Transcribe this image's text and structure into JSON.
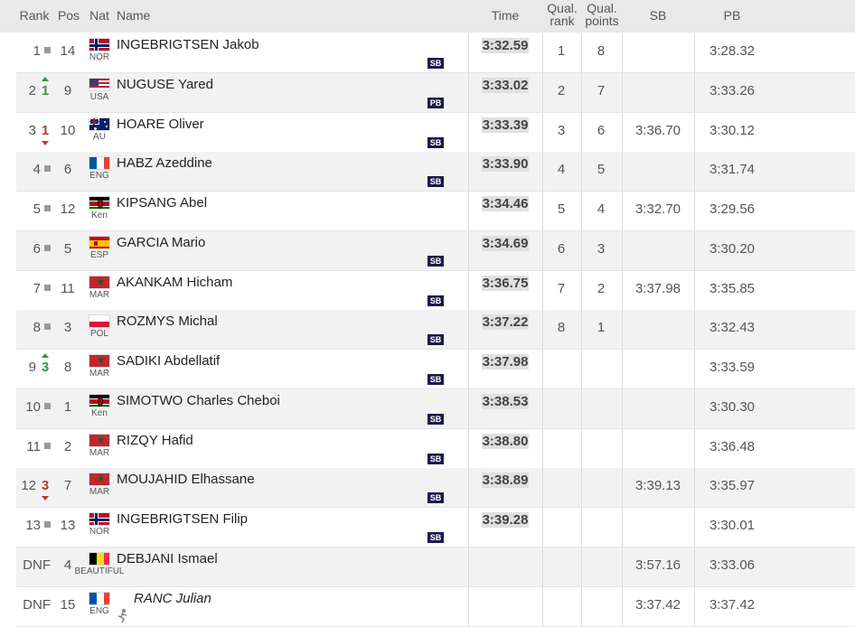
{
  "headers": {
    "rank": "Rank",
    "pos": "Pos",
    "nat": "Nat",
    "name": "Name",
    "time": "Time",
    "qual_rank_1": "Qual.",
    "qual_rank_2": "rank",
    "qual_points_1": "Qual.",
    "qual_points_2": "points",
    "sb": "SB",
    "pb": "PB"
  },
  "rows": [
    {
      "rank": "1",
      "move": "same",
      "move_n": "",
      "pos": "14",
      "flag": "flag-norway-icon",
      "nat": "NOR",
      "name": "INGEBRIGTSEN Jakob",
      "badge": "SB",
      "time": "3:32.59",
      "qual_rank": "1",
      "qual_points": "8",
      "sb": "",
      "pb": "3:28.32"
    },
    {
      "rank": "2",
      "move": "up",
      "move_n": "1",
      "pos": "9",
      "flag": "flag-usa-icon",
      "nat": "USA",
      "name": "NUGUSE Yared",
      "badge": "PB",
      "time": "3:33.02",
      "qual_rank": "2",
      "qual_points": "7",
      "sb": "",
      "pb": "3:33.26"
    },
    {
      "rank": "3",
      "move": "down",
      "move_n": "1",
      "pos": "10",
      "flag": "flag-australia-icon",
      "nat": "AU",
      "name": "HOARE Oliver",
      "badge": "SB",
      "time": "3:33.39",
      "qual_rank": "3",
      "qual_points": "6",
      "sb": "3:36.70",
      "pb": "3:30.12"
    },
    {
      "rank": "4",
      "move": "same",
      "move_n": "",
      "pos": "6",
      "flag": "flag-france-icon",
      "nat": "ENG",
      "name": "HABZ Azeddine",
      "badge": "SB",
      "time": "3:33.90",
      "qual_rank": "4",
      "qual_points": "5",
      "sb": "",
      "pb": "3:31.74"
    },
    {
      "rank": "5",
      "move": "same",
      "move_n": "",
      "pos": "12",
      "flag": "flag-kenya-icon",
      "nat": "Ken",
      "name": "KIPSANG Abel",
      "badge": "",
      "time": "3:34.46",
      "qual_rank": "5",
      "qual_points": "4",
      "sb": "3:32.70",
      "pb": "3:29.56"
    },
    {
      "rank": "6",
      "move": "same",
      "move_n": "",
      "pos": "5",
      "flag": "flag-spain-icon",
      "nat": "ESP",
      "name": "GARCIA Mario",
      "badge": "SB",
      "time": "3:34.69",
      "qual_rank": "6",
      "qual_points": "3",
      "sb": "",
      "pb": "3:30.20"
    },
    {
      "rank": "7",
      "move": "same",
      "move_n": "",
      "pos": "11",
      "flag": "flag-morocco-icon",
      "nat": "MAR",
      "name": "AKANKAM Hicham",
      "badge": "SB",
      "time": "3:36.75",
      "qual_rank": "7",
      "qual_points": "2",
      "sb": "3:37.98",
      "pb": "3:35.85"
    },
    {
      "rank": "8",
      "move": "same",
      "move_n": "",
      "pos": "3",
      "flag": "flag-poland-icon",
      "nat": "POL",
      "name": "ROZMYS Michal",
      "badge": "SB",
      "time": "3:37.22",
      "qual_rank": "8",
      "qual_points": "1",
      "sb": "",
      "pb": "3:32.43"
    },
    {
      "rank": "9",
      "move": "up",
      "move_n": "3",
      "pos": "8",
      "flag": "flag-morocco-icon",
      "nat": "MAR",
      "name": "SADIKI Abdellatif",
      "badge": "SB",
      "time": "3:37.98",
      "qual_rank": "",
      "qual_points": "",
      "sb": "",
      "pb": "3:33.59"
    },
    {
      "rank": "10",
      "move": "same",
      "move_n": "",
      "pos": "1",
      "flag": "flag-kenya-icon",
      "nat": "Ken",
      "name": "SIMOTWO Charles Cheboi",
      "badge": "SB",
      "time": "3:38.53",
      "qual_rank": "",
      "qual_points": "",
      "sb": "",
      "pb": "3:30.30"
    },
    {
      "rank": "11",
      "move": "same",
      "move_n": "",
      "pos": "2",
      "flag": "flag-morocco-icon",
      "nat": "MAR",
      "name": "RIZQY Hafid",
      "badge": "SB",
      "time": "3:38.80",
      "qual_rank": "",
      "qual_points": "",
      "sb": "",
      "pb": "3:36.48"
    },
    {
      "rank": "12",
      "move": "down",
      "move_n": "3",
      "pos": "7",
      "flag": "flag-morocco-icon",
      "nat": "MAR",
      "name": "MOUJAHID Elhassane",
      "badge": "SB",
      "time": "3:38.89",
      "qual_rank": "",
      "qual_points": "",
      "sb": "3:39.13",
      "pb": "3:35.97"
    },
    {
      "rank": "13",
      "move": "same",
      "move_n": "",
      "pos": "13",
      "flag": "flag-norway-icon",
      "nat": "NOR",
      "name": "INGEBRIGTSEN Filip",
      "badge": "SB",
      "time": "3:39.28",
      "qual_rank": "",
      "qual_points": "",
      "sb": "",
      "pb": "3:30.01"
    },
    {
      "rank": "DNF",
      "move": "none",
      "move_n": "",
      "pos": "4",
      "flag": "flag-belgium-icon",
      "nat": "BEAUTIFUL",
      "name": "DEBJANI Ismael",
      "badge": "",
      "time": "",
      "qual_rank": "",
      "qual_points": "",
      "sb": "3:57.16",
      "pb": "3:33.06"
    },
    {
      "rank": "DNF",
      "move": "none",
      "move_n": "",
      "pos": "15",
      "flag": "flag-france-icon",
      "nat": "ENG",
      "name": "RANC Julian",
      "badge": "",
      "time": "",
      "qual_rank": "",
      "qual_points": "",
      "sb": "3:37.42",
      "pb": "3:37.42",
      "runner_icon": "runner-icon",
      "italic": true
    }
  ]
}
